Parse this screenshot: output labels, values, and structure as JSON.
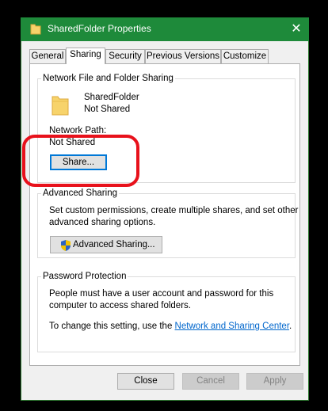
{
  "window": {
    "title": "SharedFolder Properties",
    "close_glyph": "✕"
  },
  "tabs": [
    {
      "label": "General"
    },
    {
      "label": "Sharing"
    },
    {
      "label": "Security"
    },
    {
      "label": "Previous Versions"
    },
    {
      "label": "Customize"
    }
  ],
  "network_sharing": {
    "group_label": "Network File and Folder Sharing",
    "folder_name": "SharedFolder",
    "folder_status": "Not Shared",
    "path_label": "Network Path:",
    "path_value": "Not Shared",
    "share_button": "Share..."
  },
  "advanced_sharing": {
    "group_label": "Advanced Sharing",
    "description_line1": "Set custom permissions, create multiple shares, and set other",
    "description_line2": "advanced sharing options.",
    "button": "Advanced Sharing..."
  },
  "password_protection": {
    "group_label": "Password Protection",
    "line1": "People must have a user account and password for this",
    "line2": "computer to access shared folders.",
    "change_prefix": "To change this setting, use the ",
    "link": "Network and Sharing Center",
    "change_suffix": "."
  },
  "footer": {
    "close": "Close",
    "cancel": "Cancel",
    "apply": "Apply"
  },
  "colors": {
    "titlebar": "#1e8a3a",
    "highlight": "#e8111b",
    "link": "#0066cc"
  }
}
